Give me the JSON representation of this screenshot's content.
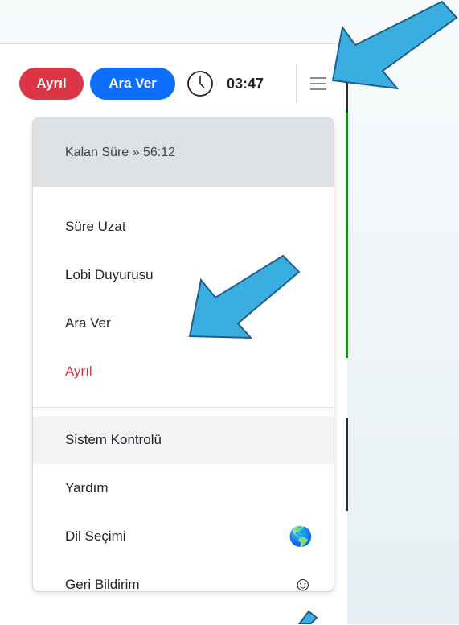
{
  "topbar": {
    "leave_label": "Ayrıl",
    "break_label": "Ara Ver",
    "timer": "03:47"
  },
  "menu": {
    "remaining": "Kalan Süre » 56:12",
    "items": [
      {
        "label": "Süre Uzat"
      },
      {
        "label": "Lobi Duyurusu"
      },
      {
        "label": "Ara Ver"
      },
      {
        "label": "Ayrıl"
      }
    ],
    "system_items": [
      {
        "label": "Sistem Kontrolü"
      },
      {
        "label": "Yardım"
      },
      {
        "label": "Dil Seçimi",
        "icon": "globe-icon",
        "glyph": "🌎"
      },
      {
        "label": "Geri Bildirim",
        "icon": "smiley-icon",
        "glyph": "☺"
      }
    ]
  },
  "colors": {
    "danger": "#dc3545",
    "primary": "#0d6efd",
    "arrow": "#3aaee0"
  }
}
